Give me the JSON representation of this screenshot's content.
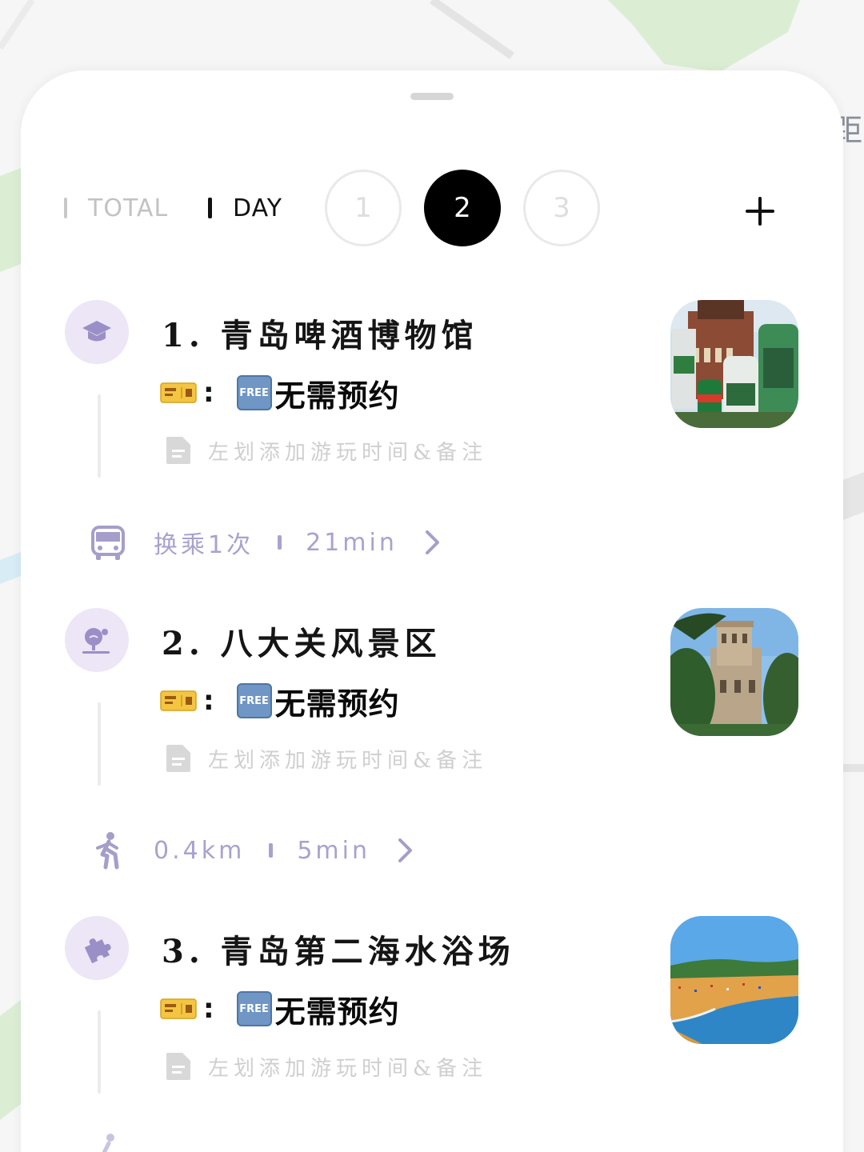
{
  "map": {
    "side_label": "距"
  },
  "tabs": {
    "total_label": "TOTAL",
    "day_label": "DAY",
    "days": [
      {
        "label": "1",
        "active": false
      },
      {
        "label": "2",
        "active": true
      },
      {
        "label": "3",
        "active": false
      }
    ],
    "add_icon": "plus-icon"
  },
  "stops": [
    {
      "title": "1. 青岛啤酒博物馆",
      "icon": "graduation-cap-icon",
      "ticket_colon": ":",
      "free_badge": "FREE",
      "ticket_text": "无需预约",
      "note_placeholder": "左划添加游玩时间&备注",
      "photo": "beer-museum-photo"
    },
    {
      "title": "2. 八大关风景区",
      "icon": "scenic-tree-icon",
      "ticket_colon": ":",
      "free_badge": "FREE",
      "ticket_text": "无需预约",
      "note_placeholder": "左划添加游玩时间&备注",
      "photo": "castle-photo"
    },
    {
      "title": "3. 青岛第二海水浴场",
      "icon": "puzzle-icon",
      "ticket_colon": ":",
      "free_badge": "FREE",
      "ticket_text": "无需预约",
      "note_placeholder": "左划添加游玩时间&备注",
      "photo": "beach-photo"
    }
  ],
  "transits": [
    {
      "mode": "bus-icon",
      "primary": "换乘1次",
      "secondary": "21min"
    },
    {
      "mode": "walk-icon",
      "primary": "0.4km",
      "secondary": "5min"
    }
  ],
  "colors": {
    "accent_purple": "#a8a2cf",
    "icon_bg": "#ece6f6",
    "active_day": "#000000"
  }
}
